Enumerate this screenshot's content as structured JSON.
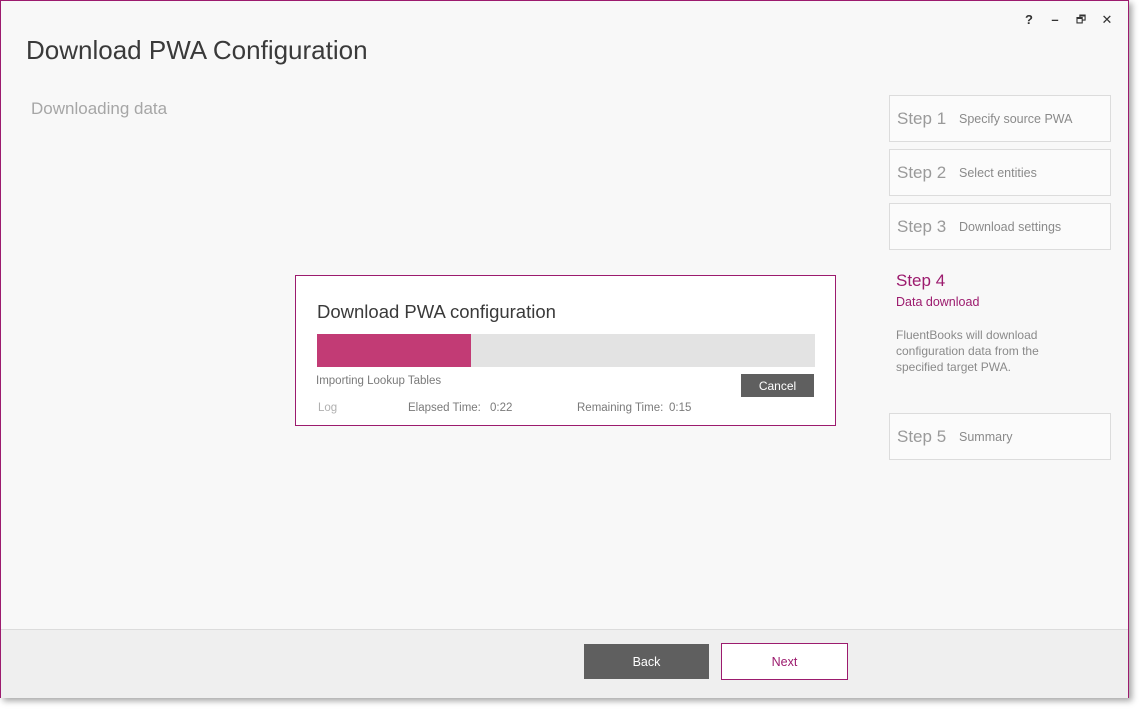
{
  "window": {
    "controls": {
      "help": "?",
      "minimize": "–",
      "restore": "🗗",
      "close": "✕"
    }
  },
  "header": {
    "title": "Download PWA Configuration",
    "subtitle": "Downloading data"
  },
  "steps": [
    {
      "num": "Step 1",
      "label": "Specify source PWA"
    },
    {
      "num": "Step 2",
      "label": "Select entities"
    },
    {
      "num": "Step 3",
      "label": "Download settings"
    },
    {
      "num": "Step 4",
      "label": "Data download",
      "description": "FluentBooks will download configuration data from the specified target PWA."
    },
    {
      "num": "Step 5",
      "label": "Summary"
    }
  ],
  "dialog": {
    "title": "Download PWA configuration",
    "progress_fraction": 0.31,
    "status": "Importing Lookup Tables",
    "cancel_label": "Cancel",
    "log_label": "Log",
    "elapsed_label": "Elapsed Time:",
    "elapsed_value": "0:22",
    "remaining_label": "Remaining Time:",
    "remaining_value": "0:15"
  },
  "footer": {
    "back_label": "Back",
    "next_label": "Next"
  },
  "colors": {
    "accent": "#9c1b6e",
    "progress": "#c23b75",
    "button_dark": "#5f5f5f"
  }
}
